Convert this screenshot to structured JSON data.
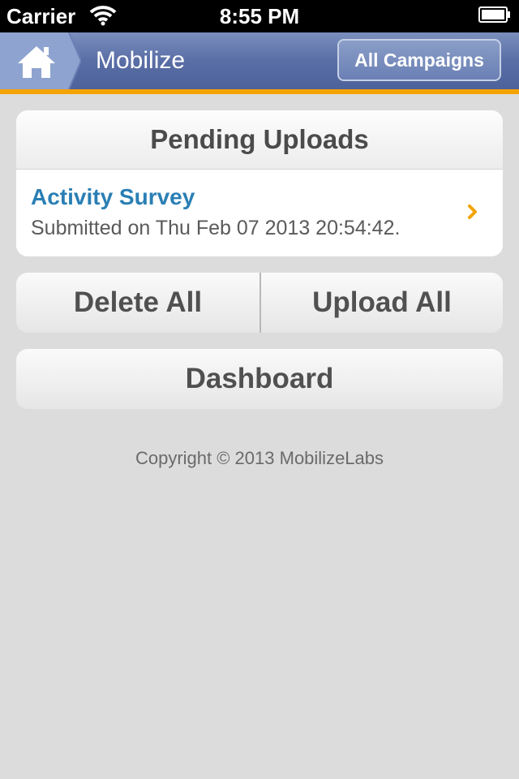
{
  "status_bar": {
    "carrier": "Carrier",
    "time": "8:55 PM"
  },
  "navbar": {
    "title": "Mobilize",
    "right_button_label": "All Campaigns",
    "home_icon": "home-icon",
    "accent_color": "#f4a300"
  },
  "pending_uploads": {
    "header": "Pending Uploads",
    "items": [
      {
        "title": "Activity Survey",
        "subtitle": "Submitted on Thu Feb 07 2013 20:54:42.",
        "chevron_color": "#f4a300"
      }
    ]
  },
  "actions": {
    "delete_all_label": "Delete All",
    "upload_all_label": "Upload All",
    "dashboard_label": "Dashboard"
  },
  "footer": {
    "copyright": "Copyright © 2013 MobilizeLabs"
  }
}
